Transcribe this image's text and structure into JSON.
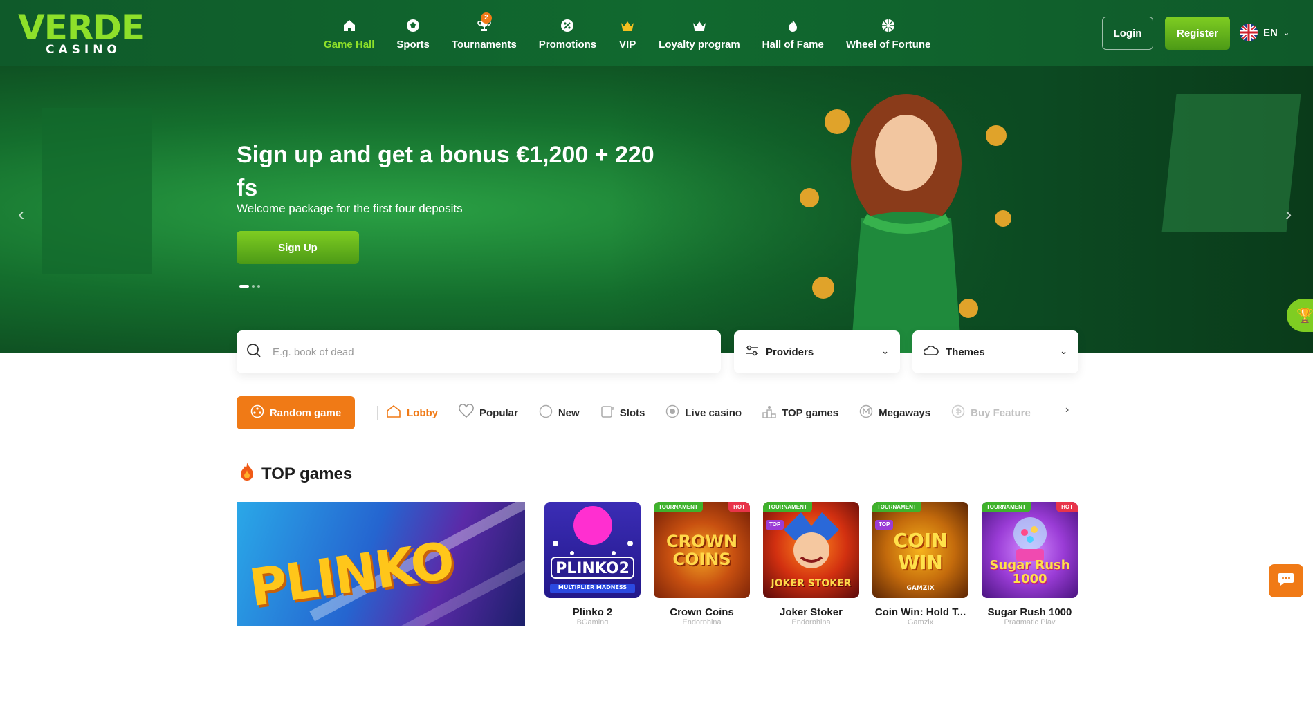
{
  "brand": {
    "logo_top": "VERDE",
    "logo_bottom": "CASINO"
  },
  "nav": [
    {
      "label": "Game Hall",
      "icon": "home-icon",
      "active": true
    },
    {
      "label": "Sports",
      "icon": "soccer-ball-icon"
    },
    {
      "label": "Tournaments",
      "icon": "trophy-icon",
      "badge": "2"
    },
    {
      "label": "Promotions",
      "icon": "promo-icon"
    },
    {
      "label": "VIP",
      "icon": "crown-icon"
    },
    {
      "label": "Loyalty program",
      "icon": "loyalty-crown-icon"
    },
    {
      "label": "Hall of Fame",
      "icon": "flame-icon"
    },
    {
      "label": "Wheel of Fortune",
      "icon": "wheel-icon"
    }
  ],
  "auth": {
    "login": "Login",
    "register": "Register"
  },
  "language": {
    "code": "EN"
  },
  "hero": {
    "title": "Sign up and get a bonus €1,200 + 220 fs",
    "subtitle": "Welcome package for the first four deposits",
    "cta": "Sign Up",
    "slide_count": 3,
    "active_slide": 1
  },
  "search": {
    "placeholder": "E.g. book of dead"
  },
  "filters": {
    "providers": "Providers",
    "themes": "Themes"
  },
  "categories": {
    "random": "Random game",
    "items": [
      {
        "label": "Lobby",
        "icon": "lobby-icon",
        "active": true
      },
      {
        "label": "Popular",
        "icon": "heart-icon"
      },
      {
        "label": "New",
        "icon": "new-icon"
      },
      {
        "label": "Slots",
        "icon": "slots-icon"
      },
      {
        "label": "Live casino",
        "icon": "live-icon"
      },
      {
        "label": "TOP games",
        "icon": "podium-icon"
      },
      {
        "label": "Megaways",
        "icon": "megaways-icon"
      },
      {
        "label": "Buy Feature",
        "icon": "coin-icon"
      }
    ]
  },
  "top_games": {
    "title": "TOP games",
    "featured": {
      "word": "PLINKO"
    },
    "games": [
      {
        "name": "Plinko 2",
        "provider": "BGaming",
        "art": "PLINKO2",
        "caption": "MULTIPLIER MADNESS",
        "tags": []
      },
      {
        "name": "Crown Coins",
        "provider": "Endorphina",
        "art": "CROWN COINS",
        "tags": [
          "TOURNAMENT",
          "HOT"
        ]
      },
      {
        "name": "Joker Stoker",
        "provider": "Endorphina",
        "art": "JOKER STOKER",
        "tags": [
          "TOURNAMENT",
          "TOP"
        ]
      },
      {
        "name": "Coin Win: Hold T...",
        "provider": "Gamzix",
        "art": "COIN WIN",
        "caption": "GAMZIX",
        "tags": [
          "TOURNAMENT",
          "TOP"
        ]
      },
      {
        "name": "Sugar Rush 1000",
        "provider": "Pragmatic Play",
        "art": "Sugar Rush 1000",
        "tags": [
          "TOURNAMENT",
          "HOT"
        ]
      }
    ]
  },
  "colors": {
    "accent_green": "#8ee02a",
    "orange": "#f07a16",
    "header_bg": "#11692f"
  }
}
